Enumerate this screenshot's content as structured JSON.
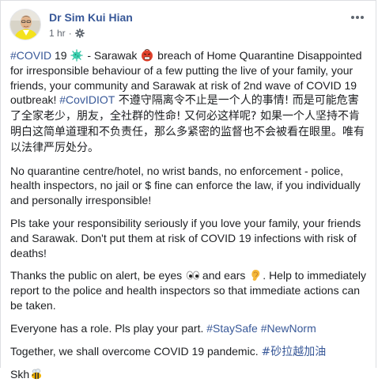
{
  "post": {
    "author": "Dr Sim Kui Hian",
    "time": "1 hr",
    "dot": "·",
    "paragraphs": {
      "p1": {
        "t1": "#COVID",
        "t2": " 19 ",
        "t3": " - Sarawak ",
        "t4": " breach of Home Quarantine Disappointed for irresponsible behaviour of a few putting the live of your family, your friends, your community and Sarawak at risk of 2nd wave of COVID 19 outbreak! ",
        "t5": "#CovIDIOT",
        "t6": " 不遵守隔离令不止是一个人的事情! 而是可能危害了全家老少，朋友，全社群的性命! 又何必这样呢? 如果一个人坚持不肯明白这简单道理和不负责任，那么多紧密的监督也不会被看在眼里。唯有以法律严厉处分。"
      },
      "p2": "No quarantine centre/hotel, no wrist bands, no enforcement - police, health inspectors, no jail or $ fine can enforce the law, if you individually and personally irresponsible!",
      "p3": "Pls take your responsibility seriously if you love your family, your friends and Sarawak. Don't put them at risk of COVID 19 infections with risk of deaths!",
      "p4": {
        "t1": "Thanks the public on alert, be eyes ",
        "t2": " and ears ",
        "t3": ". Help to immediately report to the police and health inspectors so that immediate actions can be taken."
      },
      "p5": {
        "t1": "Everyone has a role. Pls play your part. ",
        "t2": "#StaySafe",
        "t3": " ",
        "t4": "#NewNorm"
      },
      "p6": {
        "t1": "Together, we shall overcome COVID 19 pandemic. ",
        "t2": "#砂拉越加油"
      },
      "p7": "Skh"
    }
  },
  "icons": {
    "avatar": "profile-photo",
    "privacy": "gear-icon",
    "menu": "more-options-icon",
    "virus": "microbe-emoji",
    "angry": "angry-face-emoji",
    "eyes": "eyes-emoji",
    "ear": "ear-emoji",
    "bee": "bee-emoji"
  },
  "colors": {
    "link": "#385898",
    "text": "#1c1e21",
    "meta": "#606770",
    "border": "#dddfe2"
  }
}
